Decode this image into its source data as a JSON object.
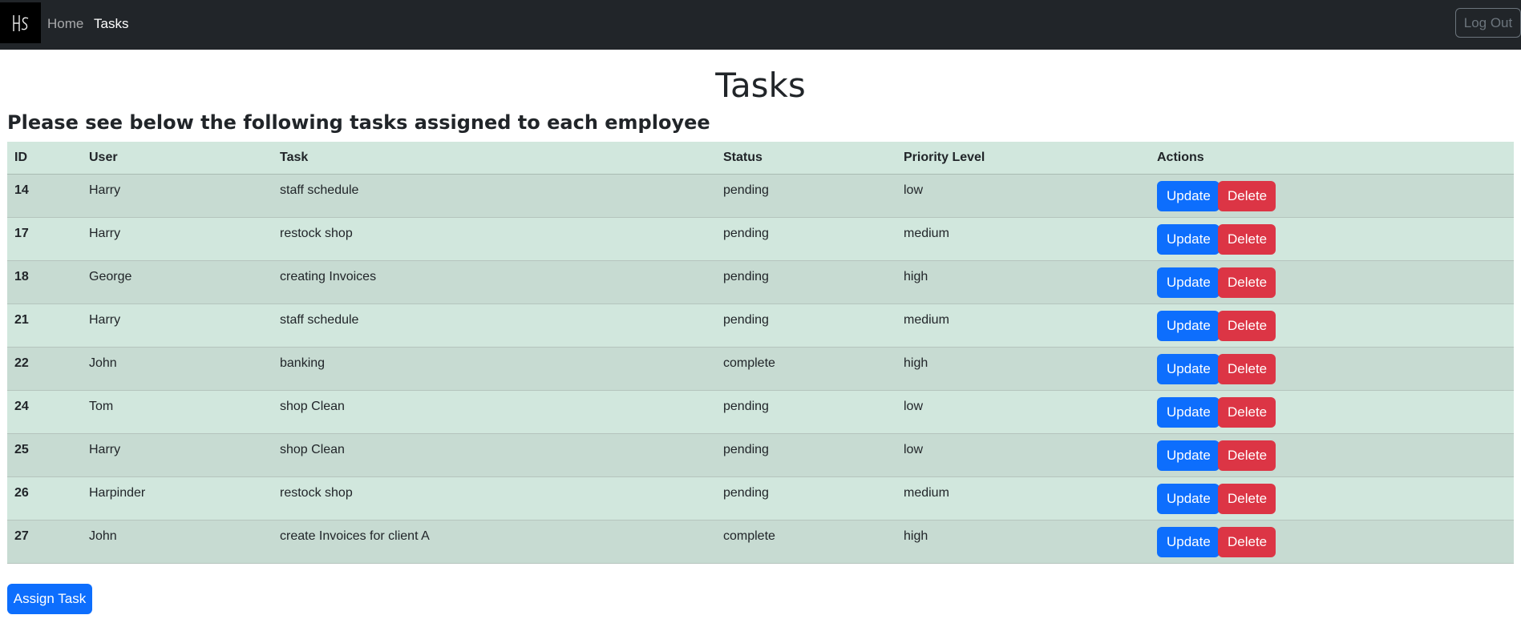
{
  "nav": {
    "logo_text": "H̶S",
    "links": [
      {
        "label": "Home"
      },
      {
        "label": "Tasks"
      }
    ],
    "logout_label": "Log Out"
  },
  "page": {
    "title": "Tasks",
    "subtitle": "Please see below the following tasks assigned to each employee"
  },
  "table": {
    "headers": [
      "ID",
      "User",
      "Task",
      "Status",
      "Priority Level",
      "Actions"
    ],
    "update_label": "Update",
    "delete_label": "Delete",
    "rows": [
      {
        "id": "14",
        "user": "Harry",
        "task": "staff schedule",
        "status": "pending",
        "priority": "low"
      },
      {
        "id": "17",
        "user": "Harry",
        "task": "restock shop",
        "status": "pending",
        "priority": "medium"
      },
      {
        "id": "18",
        "user": "George",
        "task": "creating Invoices",
        "status": "pending",
        "priority": "high"
      },
      {
        "id": "21",
        "user": "Harry",
        "task": "staff schedule",
        "status": "pending",
        "priority": "medium"
      },
      {
        "id": "22",
        "user": "John",
        "task": "banking",
        "status": "complete",
        "priority": "high"
      },
      {
        "id": "24",
        "user": "Tom",
        "task": "shop Clean",
        "status": "pending",
        "priority": "low"
      },
      {
        "id": "25",
        "user": "Harry",
        "task": "shop Clean",
        "status": "pending",
        "priority": "low"
      },
      {
        "id": "26",
        "user": "Harpinder",
        "task": "restock shop",
        "status": "pending",
        "priority": "medium"
      },
      {
        "id": "27",
        "user": "John",
        "task": "create Invoices for client A",
        "status": "complete",
        "priority": "high"
      }
    ]
  },
  "assign_label": "Assign Task",
  "colors": {
    "navbar": "#212529",
    "primary": "#0d6efd",
    "danger": "#dc3545",
    "table_header": "#d1e7dd",
    "table_row_alt": "#c7dbd2"
  }
}
